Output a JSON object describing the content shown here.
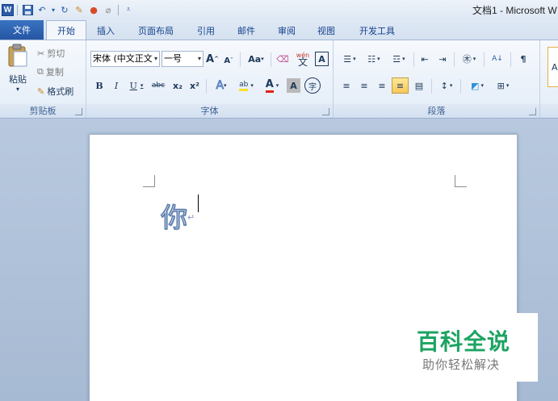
{
  "app": {
    "logo_letter": "W",
    "window_title": "文档1 - Microsoft W",
    "quick_access": {
      "undo_glyph": "↶",
      "undo_menu_glyph": "▾",
      "redo_glyph": "↻",
      "format_glyph": "✎",
      "color_glyph": "●",
      "clear_glyph": "⌀",
      "customize_glyph": "⩡"
    }
  },
  "tabs": [
    "文件",
    "开始",
    "插入",
    "页面布局",
    "引用",
    "邮件",
    "审阅",
    "视图",
    "开发工具"
  ],
  "ribbon": {
    "clipboard": {
      "label": "剪贴板",
      "paste": "粘贴",
      "paste_arrow": "▾",
      "cut": "剪切",
      "copy": "复制",
      "format_painter": "格式刷"
    },
    "font": {
      "label": "字体",
      "font_name": "宋体 (中文正文",
      "font_size": "一号",
      "grow": "A",
      "shrink": "A",
      "change_case": "Aa",
      "clear_format_glyph": "⌫",
      "phonetic": "wén",
      "border_char": "A",
      "bold": "B",
      "italic": "I",
      "underline": "U",
      "strike": "abc",
      "subscript": "x₂",
      "superscript": "x²",
      "text_effect": "A",
      "highlight": "ab",
      "font_color": "A",
      "char_shade": "A",
      "enclose": "字"
    },
    "paragraph": {
      "label": "段落",
      "bullets": "☰",
      "numbering": "☷",
      "multilevel": "☲",
      "decrease_indent": "⇤",
      "increase_indent": "⇥",
      "chinese_layout": "㊍",
      "sort": "A↓",
      "show_marks": "¶",
      "align_left": "≡",
      "center": "≡",
      "align_right": "≡",
      "justify": "≡",
      "distributed": "▤",
      "line_spacing": "↕",
      "shading": "◩",
      "borders": "⊞"
    },
    "styles": {
      "first_letter": "A"
    }
  },
  "document": {
    "text": "你",
    "paragraph_mark": "↵"
  },
  "watermark": {
    "title": "百科全说",
    "subtitle": "助你轻松解决"
  }
}
